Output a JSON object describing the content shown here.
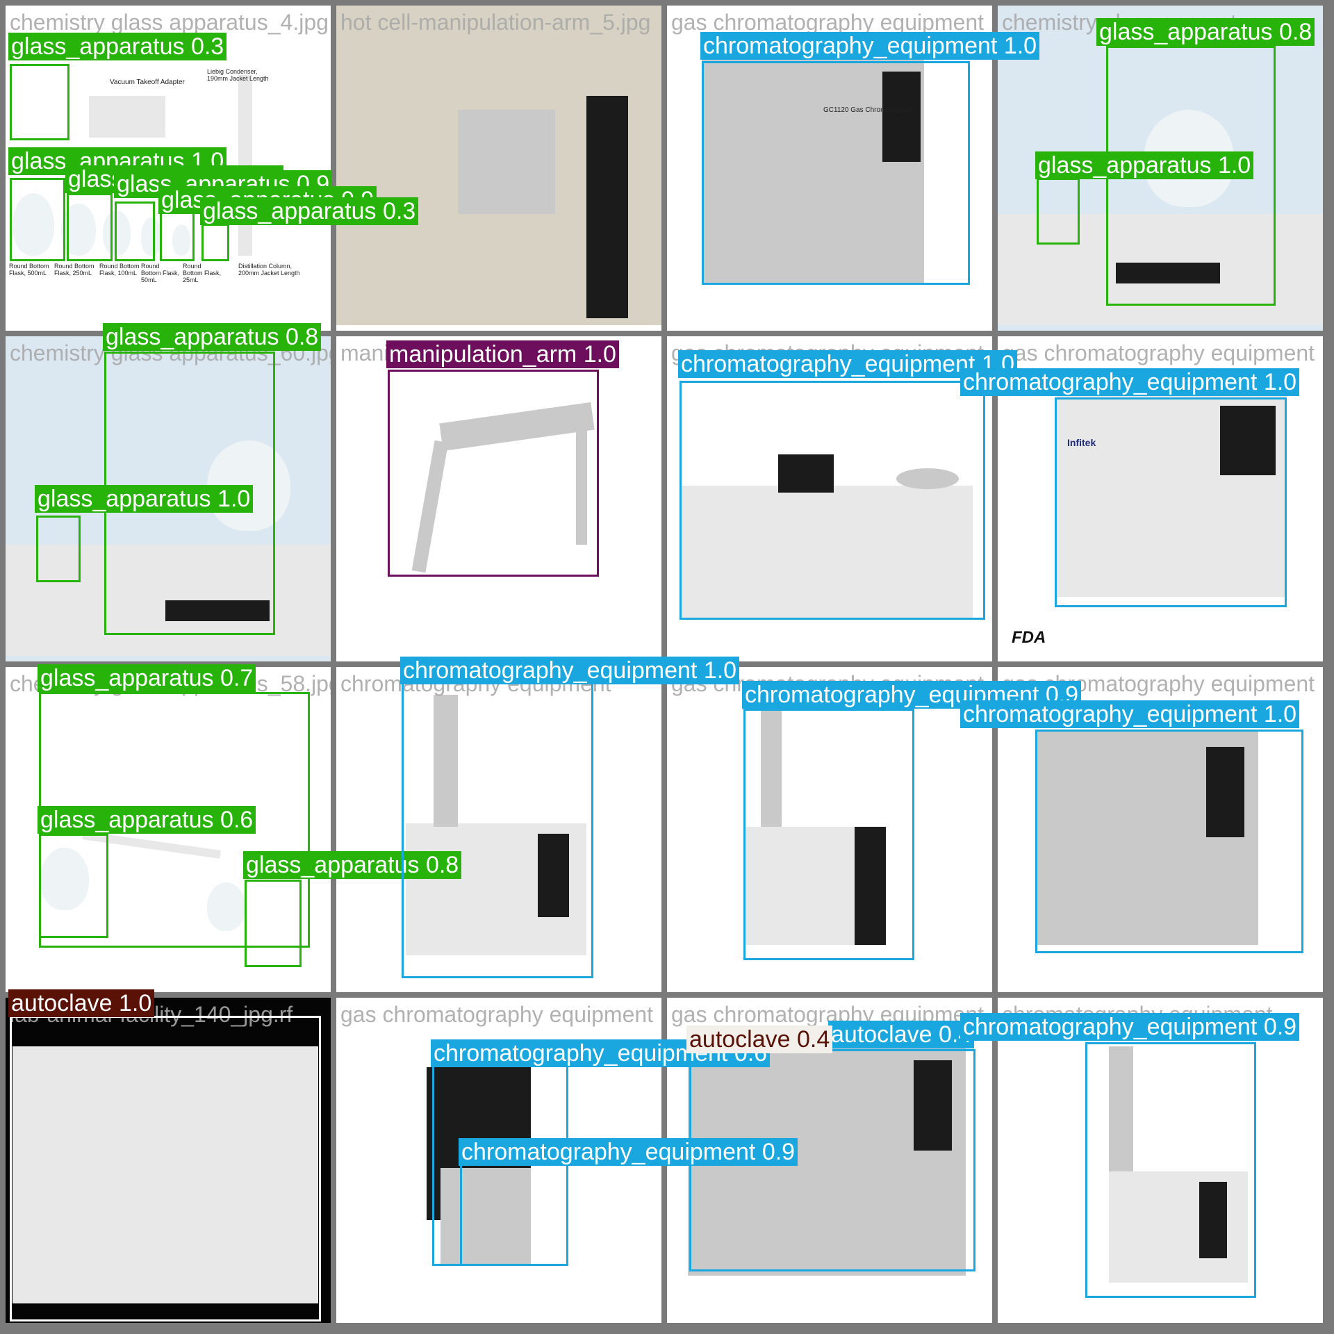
{
  "colors": {
    "glass_apparatus": "#28b30a",
    "chromatography_equipment": "#1aa7df",
    "manipulation_arm": "#6e0f5d",
    "autoclave": "#5a1207"
  },
  "tiles": [
    {
      "filename": "chemistry glass apparatus_4.jpg"
    },
    {
      "filename": "hot cell-manipulation-arm_5.jpg"
    },
    {
      "filename": "gas chromatography equipment"
    },
    {
      "filename": "chemistry glass apparatus"
    },
    {
      "filename": "chemistry glass apparatus_60.jpg"
    },
    {
      "filename": "manipulation arm_24.jpg"
    },
    {
      "filename": "gas chromatography equipment"
    },
    {
      "filename": "gas chromatography equipment"
    },
    {
      "filename": "chemistry glass apparatus_58.jpg"
    },
    {
      "filename": "chromatography equipment"
    },
    {
      "filename": "gas chromatography equipment"
    },
    {
      "filename": "gas chromatography equipment"
    },
    {
      "filename": "lab-animal-facility_140_jpg.rf"
    },
    {
      "filename": "gas chromatography equipment"
    },
    {
      "filename": "gas chromatography equipment"
    },
    {
      "filename": "chromatography equipment"
    }
  ],
  "detections": [
    {
      "label": "glass_apparatus 0.3"
    },
    {
      "label": "glass_apparatus 1.0"
    },
    {
      "label": "glass_apparatus 0.8"
    },
    {
      "label": "glass_apparatus 0.9"
    },
    {
      "label": "glass_apparatus 0.9"
    },
    {
      "label": "glass_apparatus 0.3"
    },
    {
      "label": "chromatography_equipment 1.0"
    },
    {
      "label": "glass_apparatus 0.8"
    },
    {
      "label": "glass_apparatus 1.0"
    },
    {
      "label": "glass_apparatus 0.8"
    },
    {
      "label": "glass_apparatus 1.0"
    },
    {
      "label": "manipulation_arm 1.0"
    },
    {
      "label": "chromatography_equipment 1.0"
    },
    {
      "label": "chromatography_equipment 1.0"
    },
    {
      "label": "glass_apparatus 0.7"
    },
    {
      "label": "glass_apparatus 0.6"
    },
    {
      "label": "glass_apparatus 0.8"
    },
    {
      "label": "chromatography_equipment 1.0"
    },
    {
      "label": "chromatography_equipment 0.9"
    },
    {
      "label": "chromatography_equipment 1.0"
    },
    {
      "label": "autoclave 1.0"
    },
    {
      "label": "chromatography_equipment 0.6"
    },
    {
      "label": "chromatography_equipment 0.9"
    },
    {
      "label": "autoclave 0.4"
    },
    {
      "label": "chromatography_equipment 0.9"
    },
    {
      "label": "chromatography_equipment 0.9"
    }
  ],
  "photo_text": {
    "gc_model": "GC1120 Gas Chromatograph",
    "brand": "Infitek",
    "fda": "FDA",
    "flask_500": "Round Bottom Flask, 500mL",
    "flask_250": "Round Bottom Flask, 250mL",
    "flask_100": "Round Bottom Flask, 100mL",
    "flask_50": "Round Bottom Flask, 50mL",
    "flask_25": "Round Bottom Flask, 25mL",
    "vacuum": "Vacuum Takeoff Adapter",
    "column": "Distillation Column, 200mm Jacket Length",
    "condenser": "Liebig Condenser, 190mm Jacket Length"
  }
}
